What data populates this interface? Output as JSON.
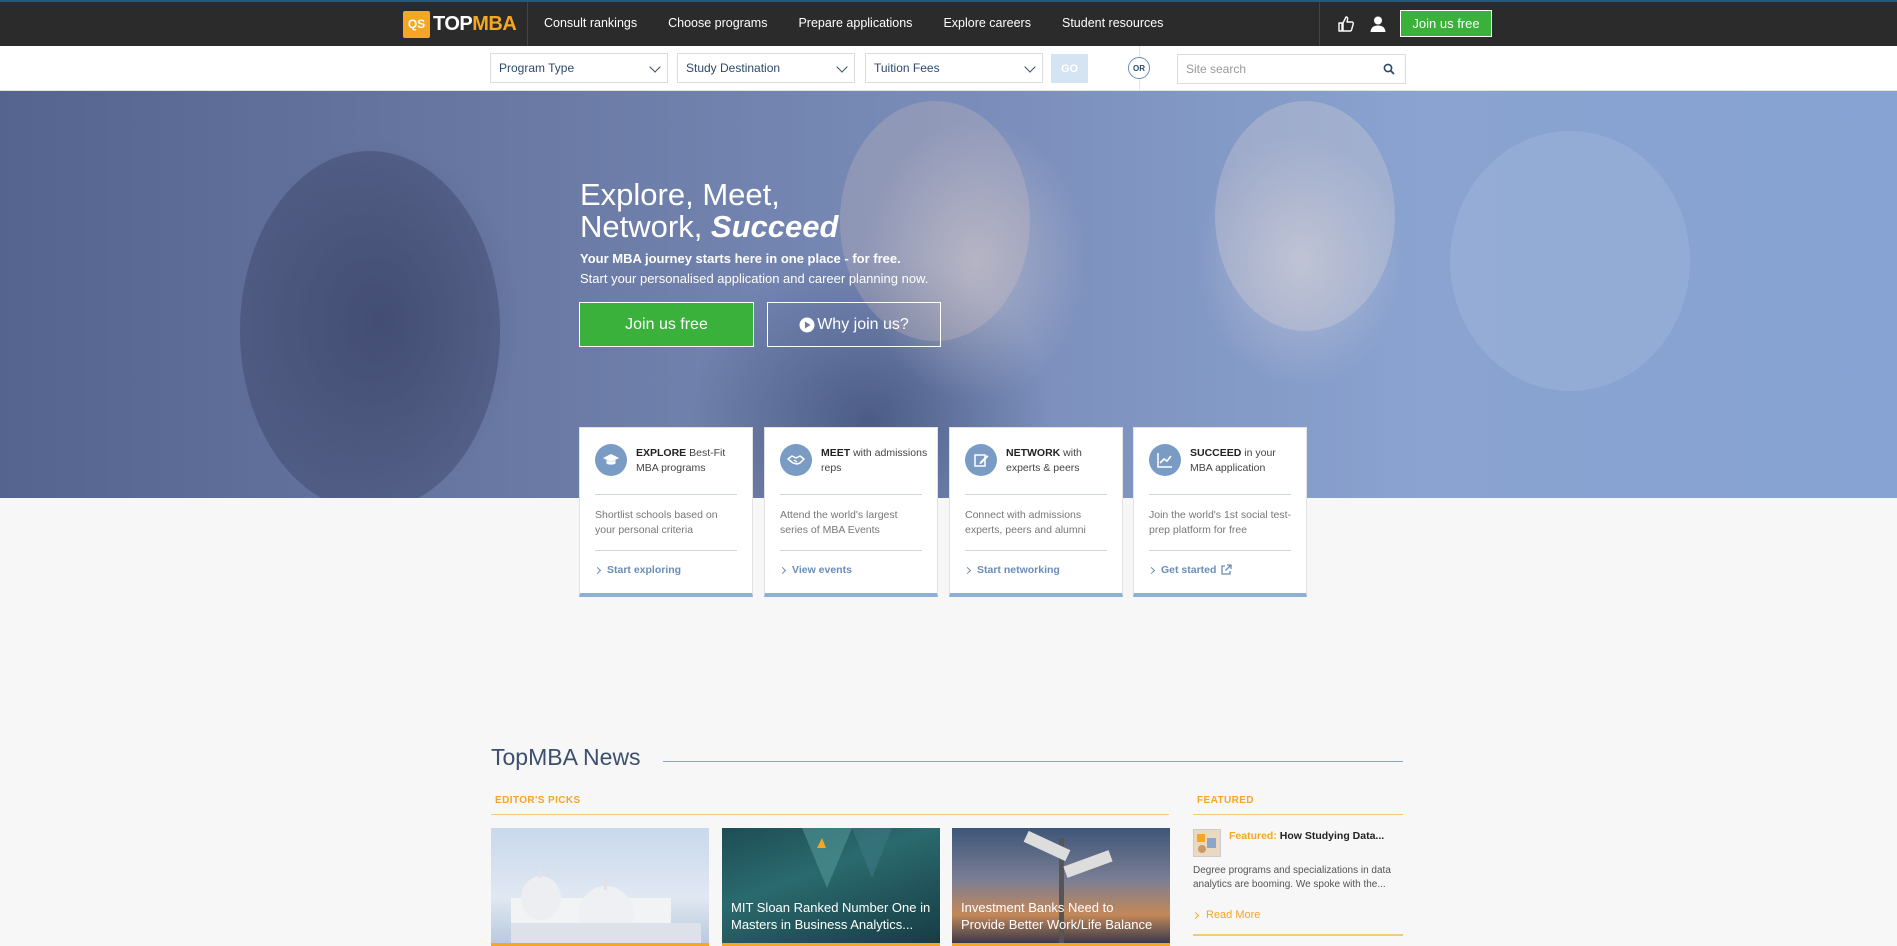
{
  "nav": {
    "logo_badge": "QS",
    "logo_top": "TOP",
    "logo_mba": "MBA",
    "links": [
      "Consult rankings",
      "Choose programs",
      "Prepare applications",
      "Explore careers",
      "Student resources"
    ],
    "join_label": "Join us free"
  },
  "filters": {
    "program_type": "Program Type",
    "study_destination": "Study Destination",
    "tuition_fees": "Tuition Fees",
    "go_label": "GO",
    "or_label": "OR",
    "search_placeholder": "Site search"
  },
  "hero": {
    "title_line1": "Explore, Meet,",
    "title_line2_a": "Network, ",
    "title_line2_b": "Succeed",
    "sub1": "Your MBA journey starts here in one place - for free.",
    "sub2": "Start your personalised application and career planning now.",
    "join_label": "Join us free",
    "why_label": "Why join us?"
  },
  "cards": [
    {
      "head_bold": "EXPLORE",
      "head_rest": " Best-Fit MBA programs",
      "body": "Shortlist schools based on your personal criteria",
      "link": "Start exploring",
      "icon": "graduation-cap-icon"
    },
    {
      "head_bold": "MEET",
      "head_rest": " with admissions reps",
      "body": "Attend the world's largest series of MBA Events",
      "link": "View events",
      "icon": "handshake-icon"
    },
    {
      "head_bold": "NETWORK",
      "head_rest": " with experts & peers",
      "body": "Connect with admissions experts, peers and alumni",
      "link": "Start networking",
      "icon": "edit-icon"
    },
    {
      "head_bold": "SUCCEED",
      "head_rest": " in your MBA application",
      "body": "Join the world's 1st social test-prep platform for free",
      "link": "Get started",
      "icon": "chart-icon"
    }
  ],
  "news": {
    "title": "TopMBA News",
    "editors_label": "EDITOR'S PICKS",
    "featured_label": "FEATURED",
    "items": [
      {
        "caption": ""
      },
      {
        "caption": "MIT Sloan Ranked Number One in Masters in Business Analytics..."
      },
      {
        "caption": "Investment Banks Need to Provide Better Work/Life Balance"
      }
    ],
    "featured": {
      "prefix": "Featured:",
      "title": " How Studying Data...",
      "body": "Degree programs and specializations in data analytics are booming. We spoke with the...",
      "read_more": "Read More"
    }
  },
  "colors": {
    "nav_bg": "#2b2b2b",
    "accent_green": "#3ab13a",
    "accent_orange": "#f5a623",
    "accent_blue": "#6a8db7"
  }
}
